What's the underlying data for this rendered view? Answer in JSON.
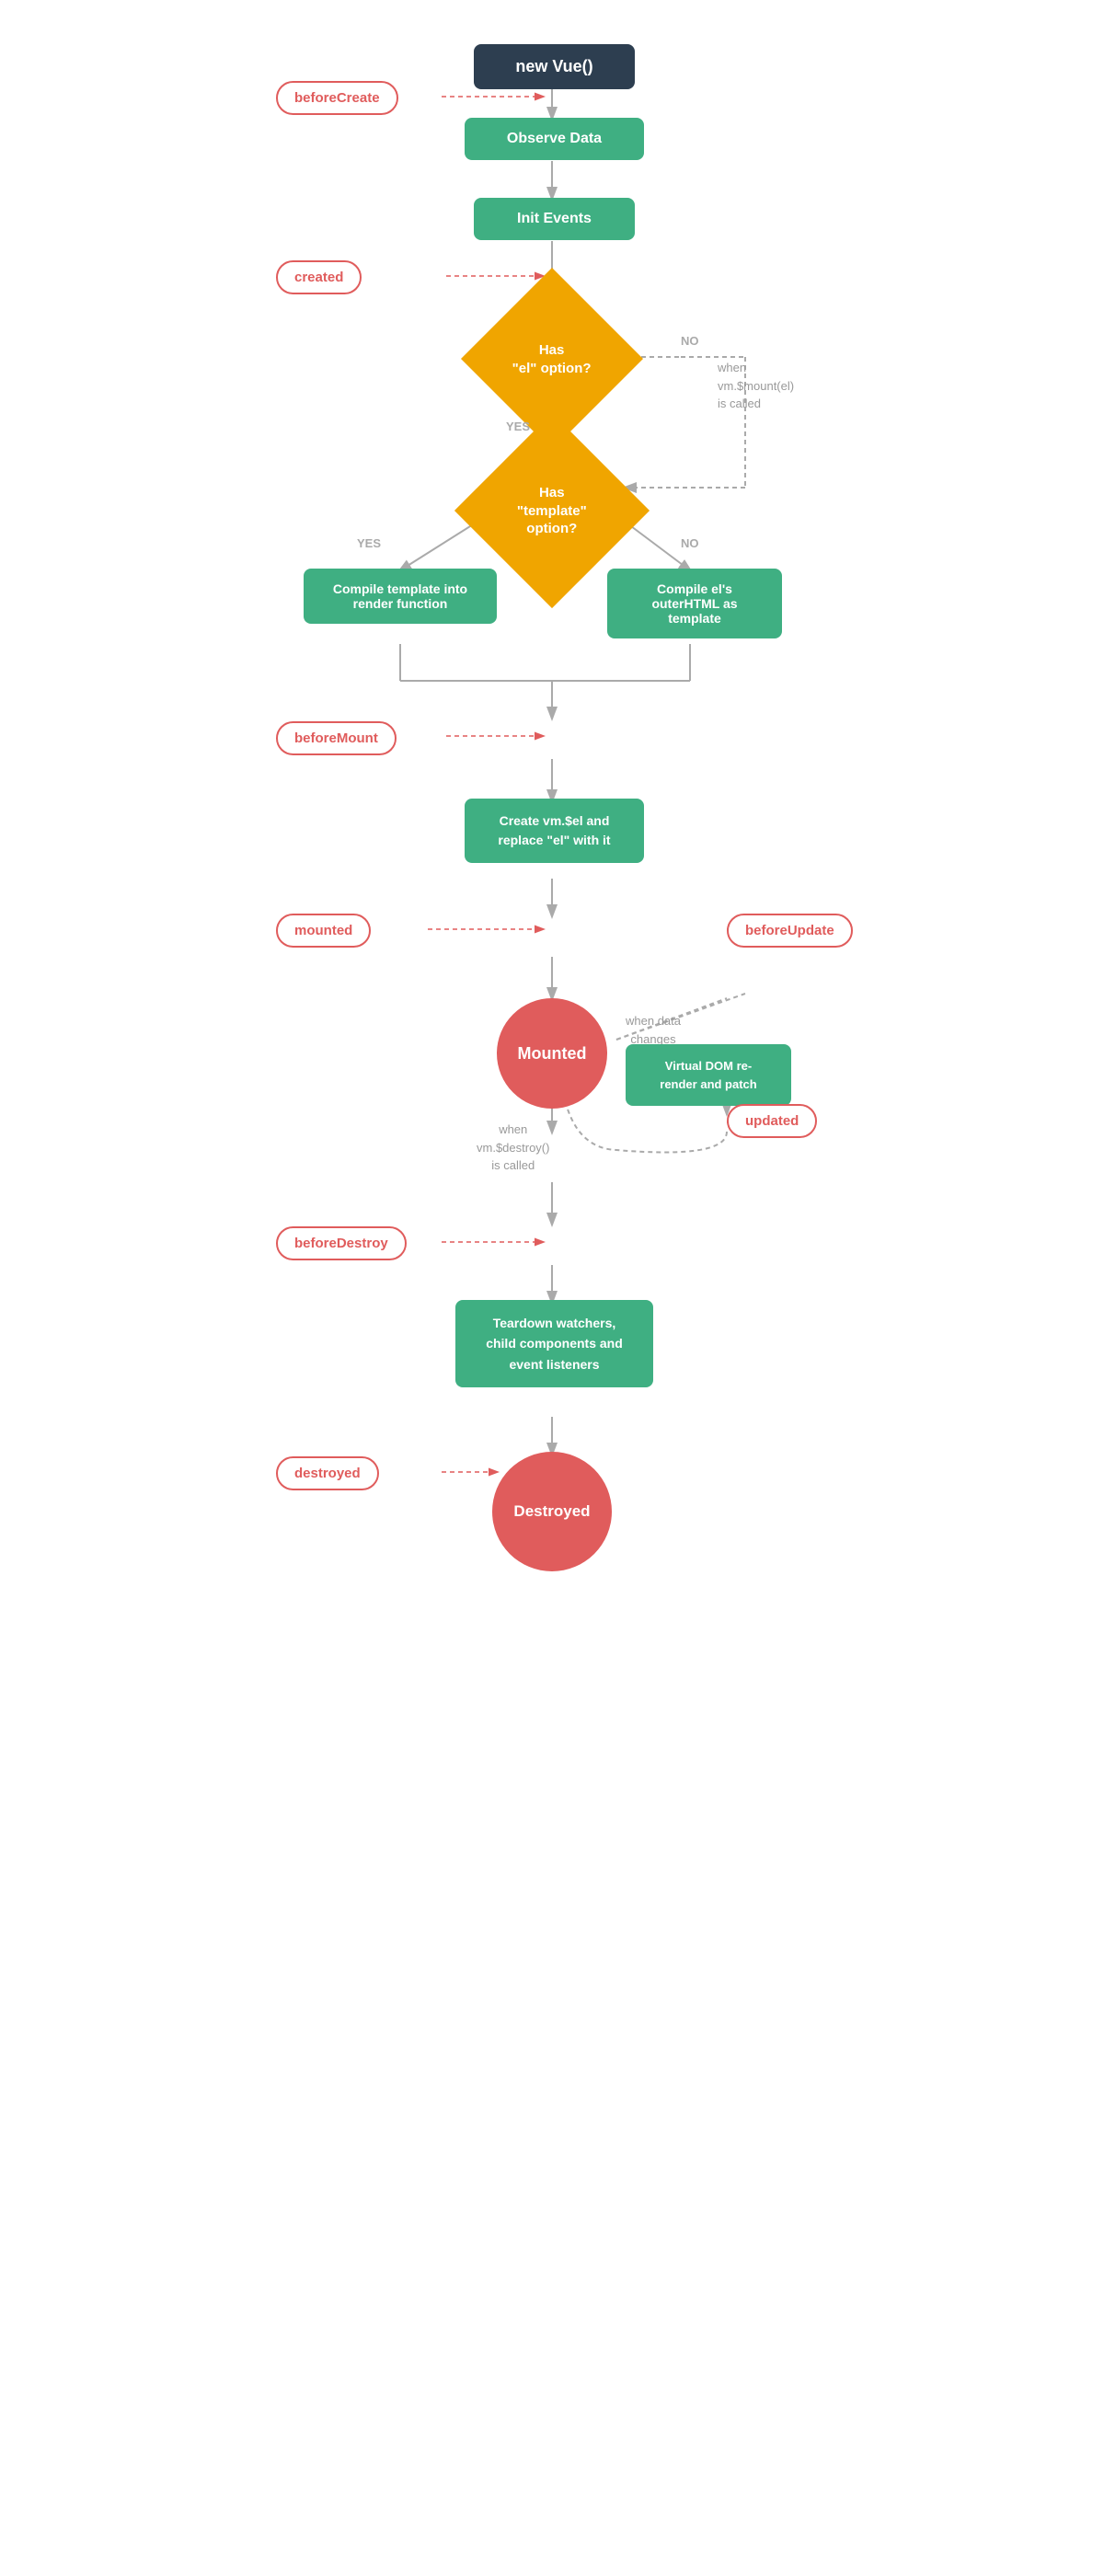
{
  "nodes": {
    "new_vue": "new Vue()",
    "before_create": "beforeCreate",
    "observe_data": "Observe Data",
    "init_events": "Init Events",
    "created": "created",
    "has_el": {
      "line1": "Has",
      "line2": "\"el\" option?"
    },
    "has_template": {
      "line1": "Has",
      "line2": "\"template\"",
      "line3": "option?"
    },
    "no_label_1": "NO",
    "yes_label_1": "YES",
    "yes_label_2": "YES",
    "no_label_2": "NO",
    "when_mount": "when\nvm.$mount(el)\nis called",
    "compile_template": "Compile template into\nrender function",
    "compile_el": "Compile el's\nouterHTML\nas template",
    "before_mount": "beforeMount",
    "create_el": "Create vm.$el\nand replace\n\"el\" with it",
    "mounted_label": "mounted",
    "before_update": "beforeUpdate",
    "mounted_circle": "Mounted",
    "when_data_changes": "when data\nchanges",
    "virtual_dom": "Virtual DOM\nre-render\nand patch",
    "updated": "updated",
    "when_destroy": "when\nvm.$destroy()\nis called",
    "before_destroy": "beforeDestroy",
    "teardown": "Teardown\nwatchers, child\ncomponents and\nevent listeners",
    "destroyed_label": "destroyed",
    "destroyed_circle": "Destroyed"
  },
  "colors": {
    "dark": "#2d3e50",
    "green": "#3faf82",
    "orange": "#f0a500",
    "red_label": "#e05c5c",
    "red_circle": "#e05c5c",
    "arrow": "#999",
    "arrow_dashed": "#e05c5c"
  }
}
